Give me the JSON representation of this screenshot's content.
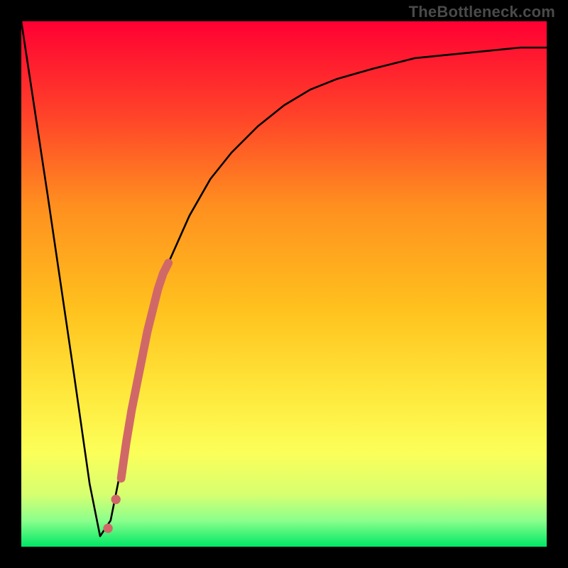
{
  "watermark": "TheBottleneck.com",
  "colors": {
    "gradient_top": "#ff0033",
    "gradient_mid1": "#ff4329",
    "gradient_mid2": "#ff8f1f",
    "gradient_mid3": "#ffc21e",
    "gradient_mid4": "#ffe63a",
    "gradient_mid5": "#fcff59",
    "gradient_mid6": "#d7ff70",
    "gradient_mid7": "#8cff8c",
    "gradient_bottom": "#00e765",
    "curve": "#000000",
    "accent_segment": "#d16868",
    "frame_bg": "#000000"
  },
  "chart_data": {
    "type": "line",
    "title": "",
    "xlabel": "",
    "ylabel": "",
    "xlim": [
      0,
      100
    ],
    "ylim": [
      0,
      100
    ],
    "grid": false,
    "series": [
      {
        "name": "bottleneck-curve",
        "x": [
          0,
          5,
          10,
          13,
          15,
          17,
          20,
          23,
          25,
          28,
          32,
          36,
          40,
          45,
          50,
          55,
          60,
          67,
          75,
          85,
          95,
          100
        ],
        "values": [
          100,
          67,
          33,
          12,
          2,
          5,
          20,
          36,
          45,
          54,
          63,
          70,
          75,
          80,
          84,
          87,
          89,
          91,
          93,
          94,
          95,
          95
        ]
      }
    ],
    "accent_segment": {
      "name": "highlighted-range",
      "x": [
        19,
        20,
        21,
        22,
        23,
        24,
        25,
        26,
        27,
        28
      ],
      "values": [
        13,
        20,
        26,
        31,
        36,
        41,
        45,
        49,
        52,
        54
      ]
    },
    "accent_dots": {
      "x": [
        16.5,
        18.0
      ],
      "values": [
        3.5,
        9.0
      ]
    }
  }
}
